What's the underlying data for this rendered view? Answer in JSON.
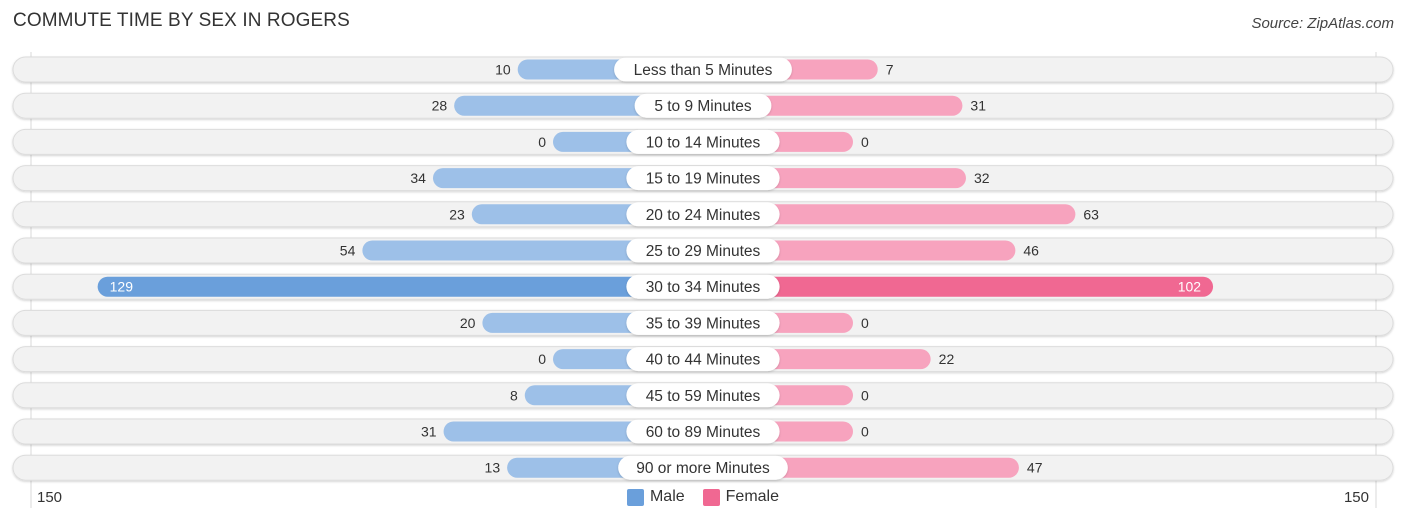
{
  "header": {
    "title": "COMMUTE TIME BY SEX IN ROGERS",
    "source": "Source: ZipAtlas.com"
  },
  "colors": {
    "male": "#6a9fdb",
    "male_light": "#9dc0e8",
    "female": "#f06892",
    "female_light": "#f7a3be",
    "track": "#f2f2f2"
  },
  "legend": {
    "male_label": "Male",
    "female_label": "Female"
  },
  "axis": {
    "left_label": "150",
    "right_label": "150"
  },
  "chart_data": {
    "type": "bar",
    "orientation": "horizontal-diverging",
    "title": "COMMUTE TIME BY SEX IN ROGERS",
    "categories": [
      "Less than 5 Minutes",
      "5 to 9 Minutes",
      "10 to 14 Minutes",
      "15 to 19 Minutes",
      "20 to 24 Minutes",
      "25 to 29 Minutes",
      "30 to 34 Minutes",
      "35 to 39 Minutes",
      "40 to 44 Minutes",
      "45 to 59 Minutes",
      "60 to 89 Minutes",
      "90 or more Minutes"
    ],
    "series": [
      {
        "name": "Male",
        "values": [
          10,
          28,
          0,
          34,
          23,
          54,
          129,
          20,
          0,
          8,
          31,
          13
        ]
      },
      {
        "name": "Female",
        "values": [
          7,
          31,
          0,
          32,
          63,
          46,
          102,
          0,
          22,
          0,
          0,
          47
        ]
      }
    ],
    "xlim": [
      -150,
      150
    ],
    "tick_labels": [
      "150",
      "150"
    ],
    "legend": [
      "Male",
      "Female"
    ],
    "legend_position": "bottom-center",
    "grid": false
  }
}
